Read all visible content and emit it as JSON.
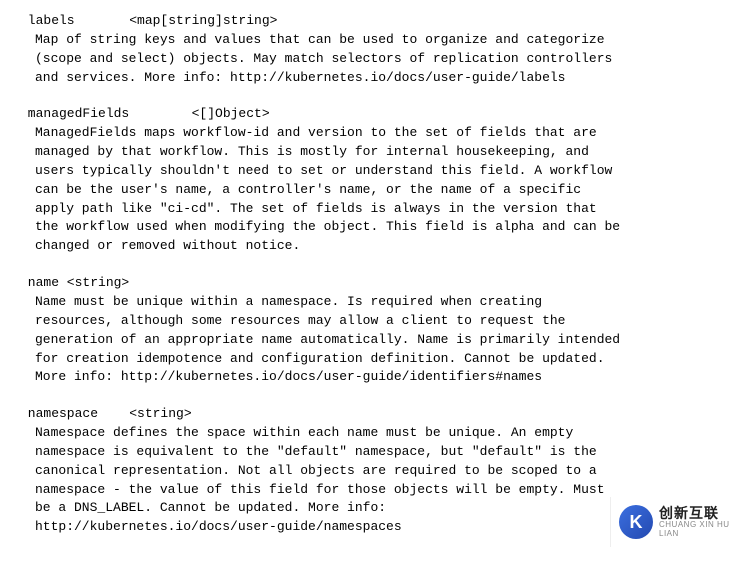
{
  "fields": [
    {
      "header": " labels       <map[string]string>",
      "desc": "Map of string keys and values that can be used to organize and categorize\n(scope and select) objects. May match selectors of replication controllers\nand services. More info: http://kubernetes.io/docs/user-guide/labels"
    },
    {
      "header": " managedFields        <[]Object>",
      "desc": "ManagedFields maps workflow-id and version to the set of fields that are\nmanaged by that workflow. This is mostly for internal housekeeping, and\nusers typically shouldn't need to set or understand this field. A workflow\ncan be the user's name, a controller's name, or the name of a specific\napply path like \"ci-cd\". The set of fields is always in the version that\nthe workflow used when modifying the object. This field is alpha and can be\nchanged or removed without notice."
    },
    {
      "header": " name <string>",
      "desc": "Name must be unique within a namespace. Is required when creating\nresources, although some resources may allow a client to request the\ngeneration of an appropriate name automatically. Name is primarily intended\nfor creation idempotence and configuration definition. Cannot be updated.\nMore info: http://kubernetes.io/docs/user-guide/identifiers#names"
    },
    {
      "header": " namespace    <string>",
      "desc": "Namespace defines the space within each name must be unique. An empty\nnamespace is equivalent to the \"default\" namespace, but \"default\" is the\ncanonical representation. Not all objects are required to be scoped to a\nnamespace - the value of this field for those objects will be empty. Must\nbe a DNS_LABEL. Cannot be updated. More info:\nhttp://kubernetes.io/docs/user-guide/namespaces"
    }
  ],
  "watermark": {
    "logo_letter": "K",
    "cn": "创新互联",
    "en": "CHUANG XIN HU LIAN"
  }
}
